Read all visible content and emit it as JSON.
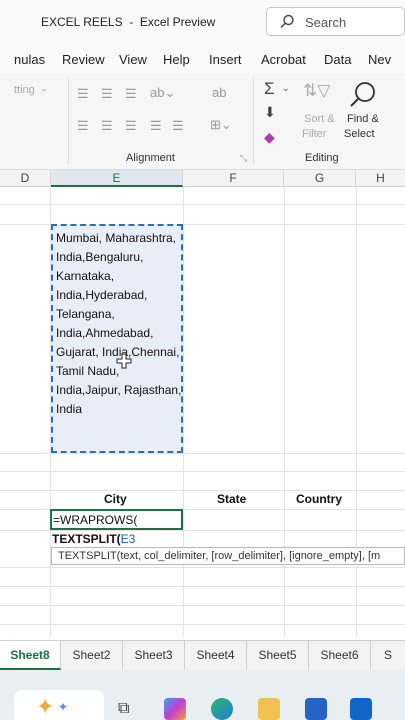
{
  "window": {
    "title": "EXCEL REELS  -  Excel Preview",
    "search_placeholder": "Search"
  },
  "menu": [
    "nulas",
    "Review",
    "View",
    "Help",
    "Insert",
    "Acrobat",
    "Data",
    "Nev"
  ],
  "ribbon": {
    "font_group_partial": "tting",
    "alignment_label": "Alignment",
    "editing_label": "Editing",
    "sort_filter": [
      "Sort &",
      "Filter"
    ],
    "find_select": [
      "Find &",
      "Select"
    ]
  },
  "columns": [
    "D",
    "E",
    "F",
    "G",
    "H"
  ],
  "cells": {
    "e_text": "Mumbai, Maharashtra, India,Bengaluru, Karnataka, India,Hyderabad, Telangana, India,Ahmedabad, Gujarat, India,Chennai, Tamil Nadu, India,Jaipur, Rajasthan, India",
    "headers": {
      "city": "City",
      "state": "State",
      "country": "Country"
    },
    "edit_value": "=WRAPROWS(",
    "formula_function": "TEXTSPLIT(",
    "formula_ref": "E3",
    "tooltip": "TEXTSPLIT(text, col_delimiter, [row_delimiter], [ignore_empty], [m"
  },
  "sheets": [
    "Sheet8",
    "Sheet2",
    "Sheet3",
    "Sheet4",
    "Sheet5",
    "Sheet6",
    "S"
  ],
  "active_sheet": "Sheet8",
  "colors": {
    "excel_green": "#1e7145",
    "selection_blue": "#2f6db5",
    "reference_blue": "#1a5fb4"
  }
}
